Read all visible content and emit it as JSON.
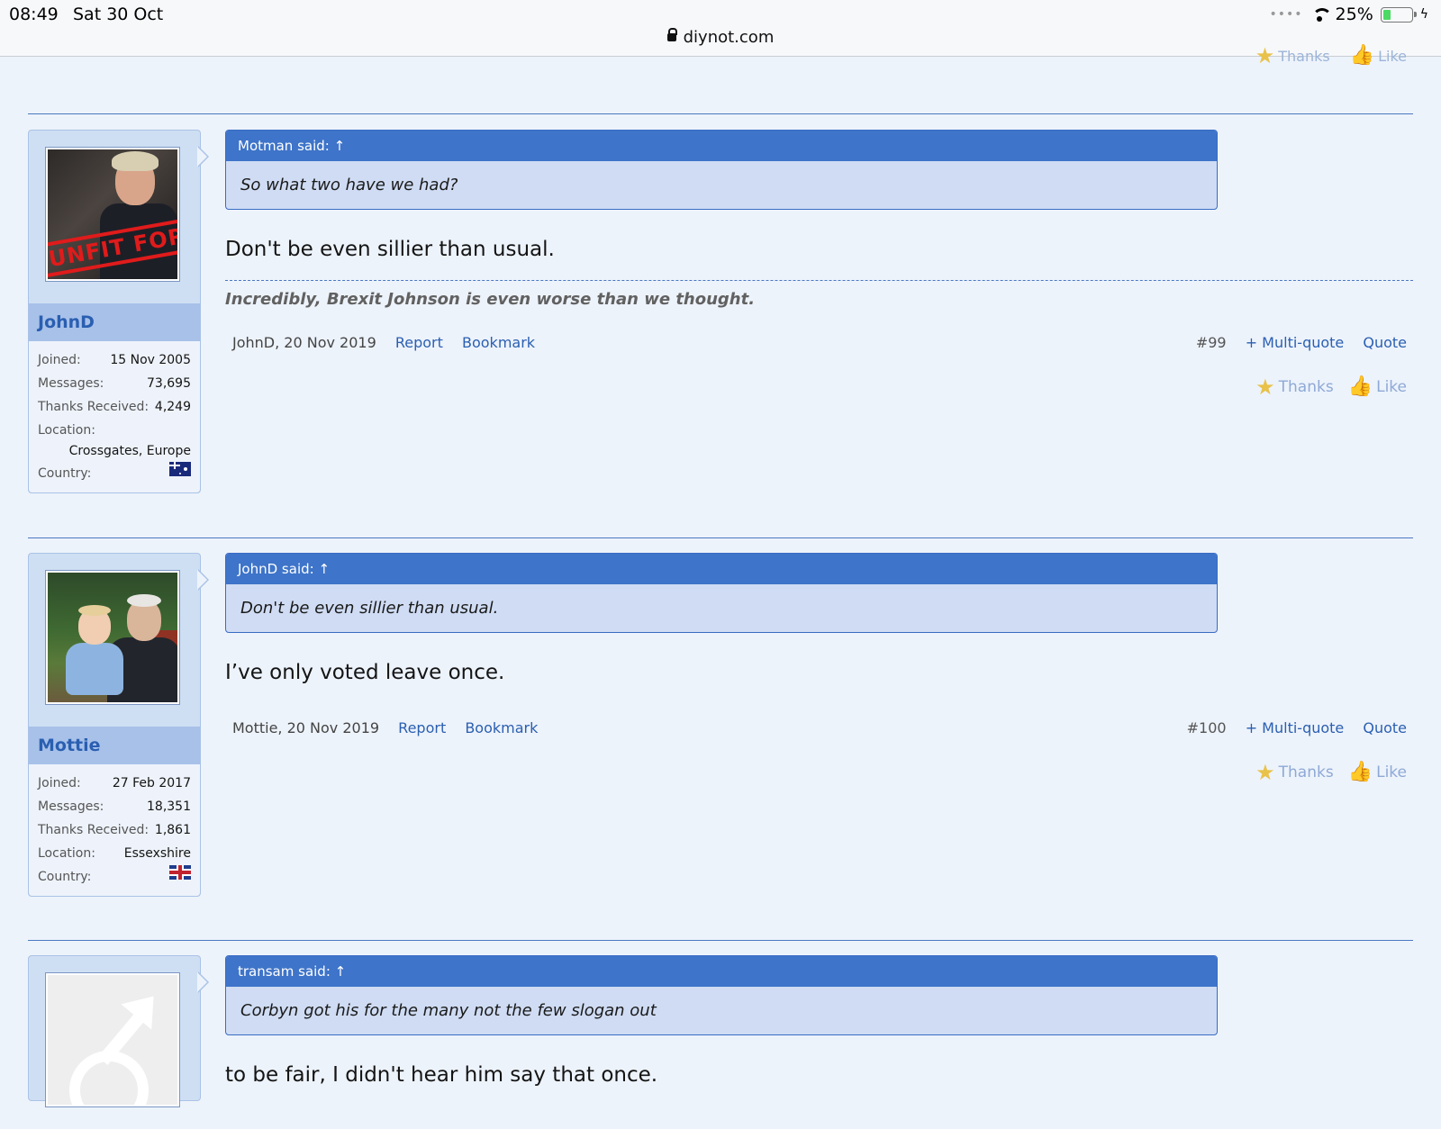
{
  "status_bar": {
    "time": "08:49",
    "date": "Sat 30 Oct",
    "url": "diynot.com",
    "battery": "25%",
    "battery_level": 0.25
  },
  "prev_post_reactions": {
    "thanks": "Thanks",
    "like": "Like"
  },
  "posts": [
    {
      "user": {
        "name": "JohnD",
        "joined_label": "Joined:",
        "joined": "15 Nov 2005",
        "messages_label": "Messages:",
        "messages": "73,695",
        "thanks_label": "Thanks Received:",
        "thanks": "4,249",
        "location_label": "Location:",
        "location": "Crossgates, Europe",
        "country_label": "Country:",
        "avatar_text": "UNFIT FOR"
      },
      "quote": {
        "header": "Motman said: ↑",
        "body": "So what two have we had?"
      },
      "message": "Don't be even sillier than usual.",
      "signature": "Incredibly, Brexit Johnson is even worse than we thought.",
      "meta": "JohnD, 20 Nov 2019",
      "report": "Report",
      "bookmark": "Bookmark",
      "number": "#99",
      "multiquote": "+ Multi-quote",
      "quote_link": "Quote",
      "thanks": "Thanks",
      "like": "Like"
    },
    {
      "user": {
        "name": "Mottie",
        "joined_label": "Joined:",
        "joined": "27 Feb 2017",
        "messages_label": "Messages:",
        "messages": "18,351",
        "thanks_label": "Thanks Received:",
        "thanks": "1,861",
        "location_label": "Location:",
        "location": "Essexshire",
        "country_label": "Country:"
      },
      "quote": {
        "header": "JohnD said: ↑",
        "body": "Don't be even sillier than usual."
      },
      "message": "I’ve only voted leave once.",
      "meta": "Mottie, 20 Nov 2019",
      "report": "Report",
      "bookmark": "Bookmark",
      "number": "#100",
      "multiquote": "+ Multi-quote",
      "quote_link": "Quote",
      "thanks": "Thanks",
      "like": "Like"
    },
    {
      "quote": {
        "header": "transam said: ↑",
        "body": "Corbyn got his for the many not the few slogan out"
      },
      "message": "to be fair, I didn't hear him say that once."
    }
  ]
}
